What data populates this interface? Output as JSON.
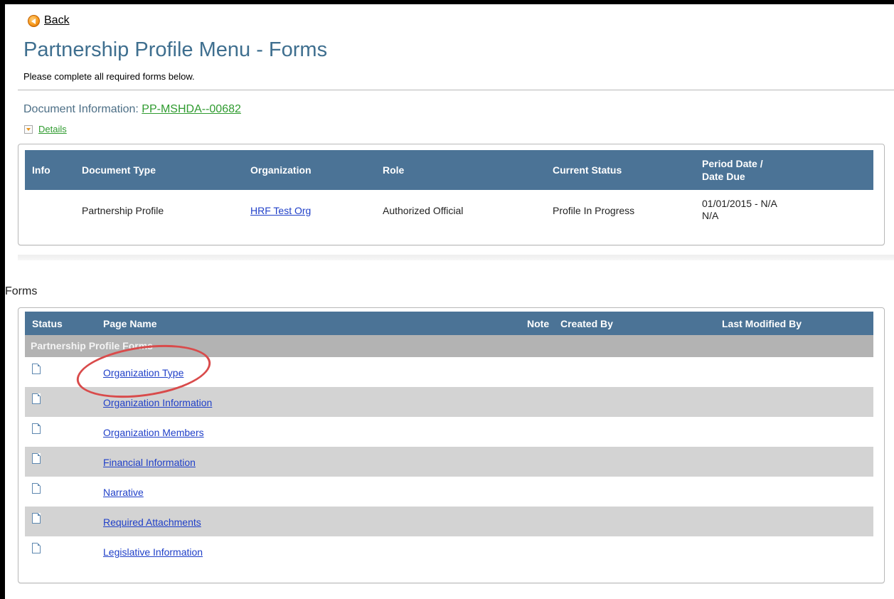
{
  "nav": {
    "back_label": "Back"
  },
  "page": {
    "title": "Partnership Profile Menu - Forms",
    "subtitle": "Please complete all required forms below."
  },
  "document_info": {
    "label": "Document Information: ",
    "id": "PP-MSHDA--00682",
    "details_label": "Details"
  },
  "doc_table": {
    "headers": {
      "info": "Info",
      "document_type": "Document Type",
      "organization": "Organization",
      "role": "Role",
      "current_status": "Current Status",
      "period_date_line1": "Period Date /",
      "period_date_line2": "Date Due"
    },
    "row": {
      "document_type": "Partnership Profile",
      "organization": "HRF Test Org",
      "role": "Authorized Official",
      "current_status": "Profile In Progress",
      "period_line1": "01/01/2015 - N/A",
      "period_line2": "N/A"
    }
  },
  "forms": {
    "section_label": "Forms",
    "headers": {
      "status": "Status",
      "page_name": "Page Name",
      "note": "Note",
      "created_by": "Created By",
      "last_modified_by": "Last Modified By"
    },
    "group_label": "Partnership Profile Forms",
    "items": [
      {
        "name": "Organization Type",
        "status_icon": "document-icon"
      },
      {
        "name": "Organization Information",
        "status_icon": "document-icon"
      },
      {
        "name": "Organization Members",
        "status_icon": "document-icon"
      },
      {
        "name": "Financial Information",
        "status_icon": "document-icon"
      },
      {
        "name": "Narrative",
        "status_icon": "document-icon"
      },
      {
        "name": "Required Attachments",
        "status_icon": "document-icon"
      },
      {
        "name": "Legislative Information",
        "status_icon": "document-icon"
      }
    ]
  },
  "colors": {
    "header_bg": "#4b7396",
    "title_text": "#3f6f8f",
    "accent_green": "#2f9b2f",
    "link_blue": "#1f3fc8",
    "alt_row": "#d3d3d3",
    "group_row": "#b3b3b3",
    "annotation_red": "#d94b4b"
  }
}
